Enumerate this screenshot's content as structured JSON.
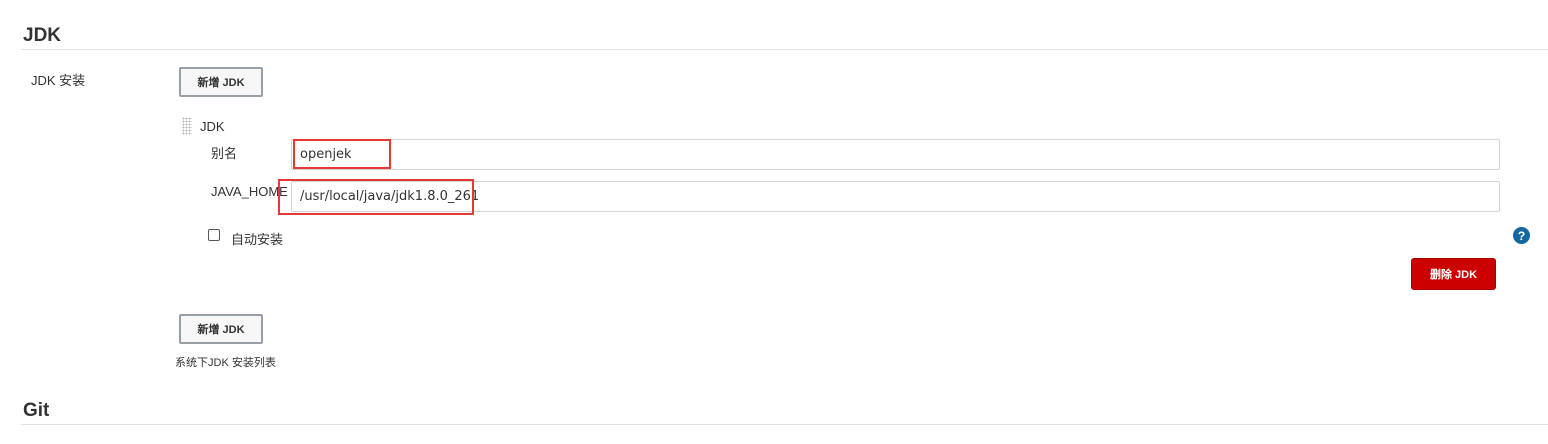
{
  "jdk_section": {
    "title": "JDK",
    "install_label": "JDK 安装",
    "add_button_label": "新增 JDK",
    "entry": {
      "header": "JDK",
      "alias_label": "别名",
      "alias_value": "openjek",
      "java_home_label": "JAVA_HOME",
      "java_home_value": "/usr/local/java/jdk1.8.0_261",
      "auto_install_label": "自动安装",
      "auto_install_checked": false,
      "delete_button_label": "删除 JDK"
    },
    "add_button_bottom_label": "新增 JDK",
    "list_hint": "系统下JDK 安装列表"
  },
  "git_section": {
    "title": "Git"
  },
  "colors": {
    "delete_button": "#cc0000",
    "highlight_box": "#e53935",
    "help_icon": "#14679e"
  },
  "icons": {
    "help": "help-icon",
    "drag": "drag-handle-icon"
  }
}
